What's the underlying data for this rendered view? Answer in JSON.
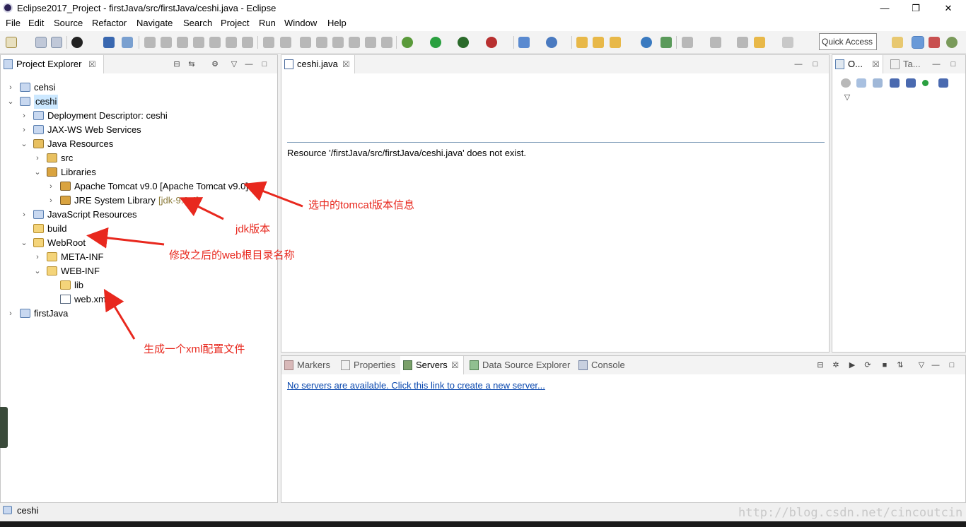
{
  "window": {
    "title": "Eclipse2017_Project - firstJava/src/firstJava/ceshi.java - Eclipse",
    "minimize": "—",
    "restore": "❐",
    "close": "✕"
  },
  "menu": [
    "File",
    "Edit",
    "Source",
    "Refactor",
    "Navigate",
    "Search",
    "Project",
    "Run",
    "Window",
    "Help"
  ],
  "toolbar": {
    "quick_access": "Quick Access",
    "icons": [
      "new-icon",
      "save-icon",
      "save-all-icon",
      "profile-icon",
      "console-icon",
      "debug-icon",
      "run-icon",
      "coverage-icon",
      "external-tools-icon",
      "new-server-icon",
      "open-type-icon",
      "search-icon",
      "globe-icon",
      "next-annotation-icon",
      "back-icon",
      "forward-icon",
      "open-perspective-icon",
      "java-ee-perspective-icon",
      "debug-perspective-icon"
    ]
  },
  "project_explorer": {
    "tab_label": "Project Explorer",
    "tab_close": "☒",
    "items": [
      {
        "label": "cehsi",
        "decoration": "",
        "depth": 0,
        "expanded": false,
        "icon": "project",
        "selected": false
      },
      {
        "label": "ceshi",
        "decoration": "",
        "depth": 0,
        "expanded": true,
        "icon": "project",
        "selected": true
      },
      {
        "label": "Deployment Descriptor: ceshi",
        "decoration": "",
        "depth": 1,
        "expanded": false,
        "icon": "descriptor",
        "selected": false
      },
      {
        "label": "JAX-WS Web Services",
        "decoration": "",
        "depth": 1,
        "expanded": false,
        "icon": "webservice",
        "selected": false
      },
      {
        "label": "Java Resources",
        "decoration": "",
        "depth": 1,
        "expanded": true,
        "icon": "javares",
        "selected": false
      },
      {
        "label": "src",
        "decoration": "",
        "depth": 2,
        "expanded": false,
        "icon": "package",
        "selected": false
      },
      {
        "label": "Libraries",
        "decoration": "",
        "depth": 2,
        "expanded": true,
        "icon": "library",
        "selected": false
      },
      {
        "label": "Apache Tomcat v9.0 [Apache Tomcat v9.0]",
        "decoration": "",
        "depth": 3,
        "expanded": false,
        "icon": "library",
        "selected": false
      },
      {
        "label": "JRE System Library",
        "decoration": "[jdk-9.0.4]",
        "depth": 3,
        "expanded": false,
        "icon": "library",
        "selected": false
      },
      {
        "label": "JavaScript Resources",
        "decoration": "",
        "depth": 1,
        "expanded": false,
        "icon": "jsres",
        "selected": false
      },
      {
        "label": "build",
        "decoration": "",
        "depth": 1,
        "expanded": null,
        "icon": "folder",
        "selected": false
      },
      {
        "label": "WebRoot",
        "decoration": "",
        "depth": 1,
        "expanded": true,
        "icon": "folder",
        "selected": false
      },
      {
        "label": "META-INF",
        "decoration": "",
        "depth": 2,
        "expanded": false,
        "icon": "folder",
        "selected": false
      },
      {
        "label": "WEB-INF",
        "decoration": "",
        "depth": 2,
        "expanded": true,
        "icon": "folder",
        "selected": false
      },
      {
        "label": "lib",
        "decoration": "",
        "depth": 3,
        "expanded": null,
        "icon": "folder",
        "selected": false
      },
      {
        "label": "web.xml",
        "decoration": "",
        "depth": 3,
        "expanded": null,
        "icon": "xml",
        "selected": false
      },
      {
        "label": "firstJava",
        "decoration": "",
        "depth": 0,
        "expanded": false,
        "icon": "project",
        "selected": false
      }
    ]
  },
  "editor": {
    "tab_label": "ceshi.java",
    "tab_close": "☒",
    "message": "Resource '/firstJava/src/firstJava/ceshi.java' does not exist."
  },
  "outline": {
    "tabs": [
      {
        "label": "O..."
      },
      {
        "label": "Ta..."
      }
    ]
  },
  "bottom_panel": {
    "tabs": [
      {
        "label": "Markers",
        "active": false
      },
      {
        "label": "Properties",
        "active": false
      },
      {
        "label": "Servers",
        "active": true
      },
      {
        "label": "Data Source Explorer",
        "active": false
      },
      {
        "label": "Console",
        "active": false
      }
    ],
    "servers_link": "No servers are available. Click this link to create a new server..."
  },
  "annotations": {
    "tomcat": "选中的tomcat版本信息",
    "jdk": "jdk版本",
    "webroot": "修改之后的web根目录名称",
    "xml": "生成一个xml配置文件"
  },
  "status": {
    "selection": "ceshi",
    "watermark": "http://blog.csdn.net/cincoutcin"
  },
  "colors": {
    "annotation_red": "#e8281e",
    "selection_bg": "#cce8ff",
    "link_blue": "#0645ad",
    "decoration_olive": "#8b7b3a"
  }
}
